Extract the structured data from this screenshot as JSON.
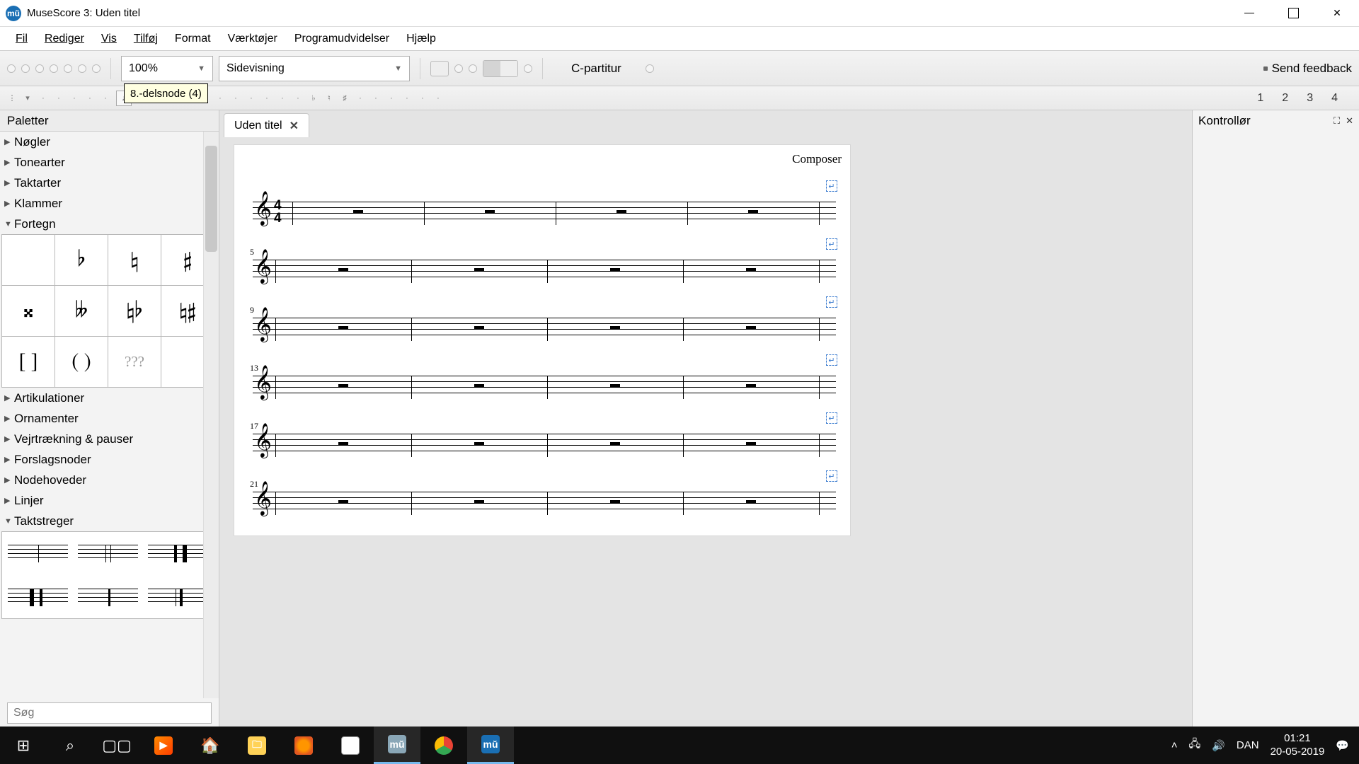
{
  "titlebar": {
    "app_icon": "mŭ",
    "title": "MuseScore 3: Uden titel"
  },
  "menu": {
    "items": [
      "Fil",
      "Rediger",
      "Vis",
      "Tilføj",
      "Format",
      "Værktøjer",
      "Programudvidelser",
      "Hjælp"
    ]
  },
  "toolbar": {
    "zoom": "100%",
    "view_mode": "Sidevisning",
    "concert_pitch": "C-partitur",
    "feedback": "Send feedback"
  },
  "toolbar2": {
    "tooltip": "8.-delsnode (4)",
    "voice_numbers": [
      "1",
      "2",
      "3",
      "4"
    ]
  },
  "palette": {
    "title": "Paletter",
    "items_top": [
      "Nøgler",
      "Tonearter",
      "Taktarter",
      "Klammer"
    ],
    "expanded1": "Fortegn",
    "accidentals": [
      "",
      "♭",
      "♮",
      "♯",
      "𝄪",
      "𝄫",
      "♮♭",
      "♮♯",
      "[ ]",
      "( )",
      "???"
    ],
    "items_mid": [
      "Artikulationer",
      "Ornamenter",
      "Vejrtrækning & pauser",
      "Forslagsnoder",
      "Nodehoveder",
      "Linjer"
    ],
    "expanded2": "Taktstreger",
    "search_placeholder": "Søg"
  },
  "score": {
    "tab_title": "Uden titel",
    "composer": "Composer",
    "systems": [
      {
        "measure_number": "",
        "show_tsig": true
      },
      {
        "measure_number": "5",
        "show_tsig": false
      },
      {
        "measure_number": "9",
        "show_tsig": false
      },
      {
        "measure_number": "13",
        "show_tsig": false
      },
      {
        "measure_number": "17",
        "show_tsig": false
      },
      {
        "measure_number": "21",
        "show_tsig": false
      }
    ],
    "time_sig_top": "4",
    "time_sig_bot": "4"
  },
  "inspector": {
    "title": "Kontrollør"
  },
  "taskbar": {
    "lang": "DAN",
    "time": "01:21",
    "date": "20-05-2019"
  }
}
